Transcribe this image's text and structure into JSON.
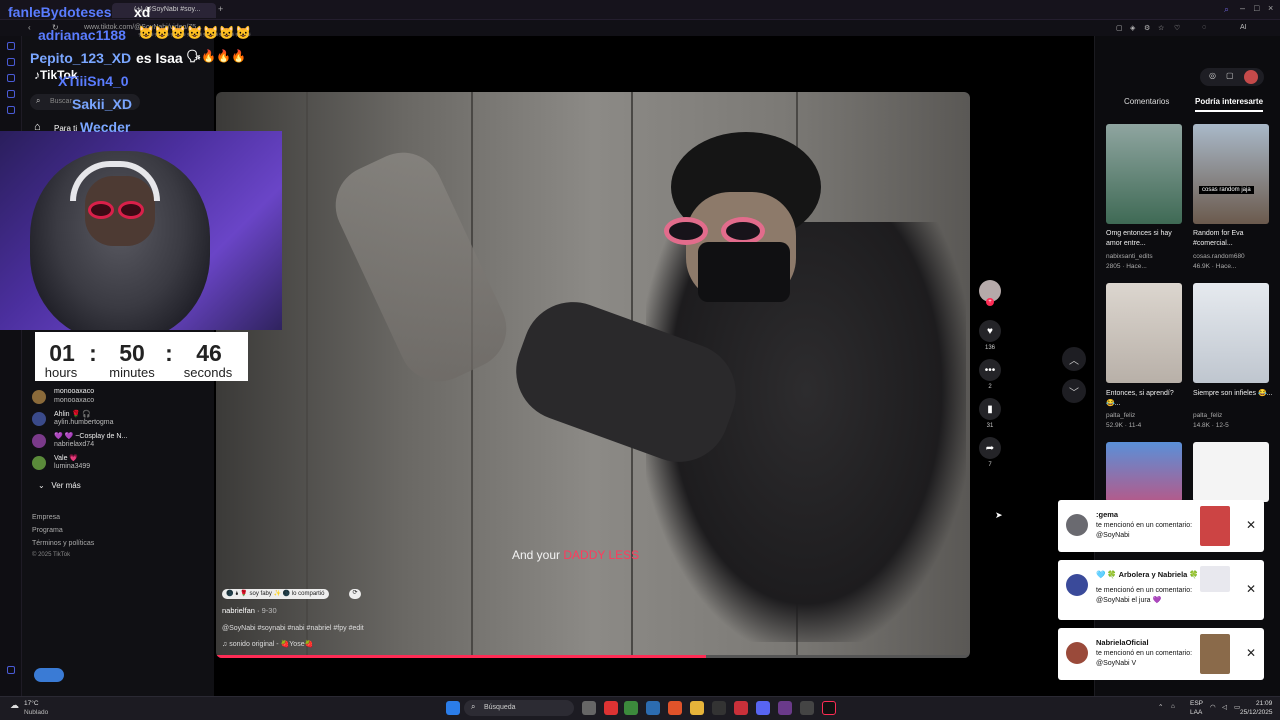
{
  "chat": {
    "line1_user": "fanleBydoteses",
    "line1_msg": "xd",
    "line2_user": "adrianac1188",
    "line3_user": "Pepito_123_XD",
    "line3_msg": "es Isaa",
    "line4_user": "XTiiiSn4_0",
    "line5_user": "Sakii_XD",
    "line6_user": "Wecder"
  },
  "browser": {
    "url": "www.tiktok.com/@SoyNabi/video/75...",
    "tab_label": "(+) @SoyNabi #soy..."
  },
  "tiktok": {
    "logo": "TikTok",
    "search_placeholder": "Buscar",
    "nav_foryou": "Para ti",
    "following": [
      {
        "name": "monooaxaco",
        "handle": "monooaxaco"
      },
      {
        "name": "Ahlin 🌹 🎧",
        "handle": "aylin.humbertogma"
      },
      {
        "name": "💜 💜 ~Cosplay de N...",
        "handle": "nabrielaxd74"
      },
      {
        "name": "Vale 💗",
        "handle": "lumina3499"
      }
    ],
    "see_more": "Ver más",
    "footer": [
      "Empresa",
      "Programa",
      "Términos y políticas",
      "© 2025 TikTok"
    ]
  },
  "timer": {
    "hours": "01",
    "minutes": "50",
    "seconds": "46",
    "hours_label": "hours",
    "minutes_label": "minutes",
    "seconds_label": "seconds"
  },
  "video": {
    "caption_pre": "And your",
    "caption_hl": "DADDY LESS",
    "author_badge": "🌑 🌢 🌹 soy faby ✨ 🌑 lo compartió",
    "author": "nabrielfan",
    "date": "9-30",
    "hashtags": "@SoyNabi #soynabi #nabi #nabriel #fpy #edit",
    "sound": "sonido original - 🍓Yose🍓",
    "progress": 0.65
  },
  "actions": {
    "likes": "136",
    "comments": "2",
    "saves": "31",
    "shares": "7"
  },
  "right_panel": {
    "tab_comments": "Comentarios",
    "tab_related": "Podría interesarte",
    "items": [
      {
        "title": "Omg entonces si hay amor entre...",
        "user": "nabixsanti_edits",
        "stats": "2805 · Hace..."
      },
      {
        "title": "Random for Eva #comercial...",
        "user": "cosas.random680",
        "stats": "46.9K · Hace...",
        "overlay": "cosas random jaja"
      },
      {
        "title": "Entonces, si aprendí? 😂...",
        "user": "palta_feliz",
        "stats": "52.9K · 11-4"
      },
      {
        "title": "Siempre son infieles 😂...",
        "user": "palta_feliz",
        "stats": "14.8K · 12-5"
      }
    ]
  },
  "notifications": [
    {
      "title": ":gema",
      "text": "te mencionó en un comentario: @SoyNabi"
    },
    {
      "title": "🩵 🍀 Arbolera y Nabriela 🍀 💜",
      "text": "te mencionó en un comentario: @SoyNabi el jura 💜"
    },
    {
      "title": "NabrielaOficial",
      "text": "te mencionó en un comentario: @SoyNabi V"
    }
  ],
  "taskbar": {
    "weather_temp": "17°C",
    "weather_desc": "Nublado",
    "search": "Búsqueda",
    "lang1": "ESP",
    "lang2": "LAA",
    "time": "21:09",
    "date": "25/12/2025"
  },
  "colors": {
    "accent": "#fe2c55",
    "chat_name": "#5a7cff",
    "chat_cyan": "#7aa6ff"
  }
}
